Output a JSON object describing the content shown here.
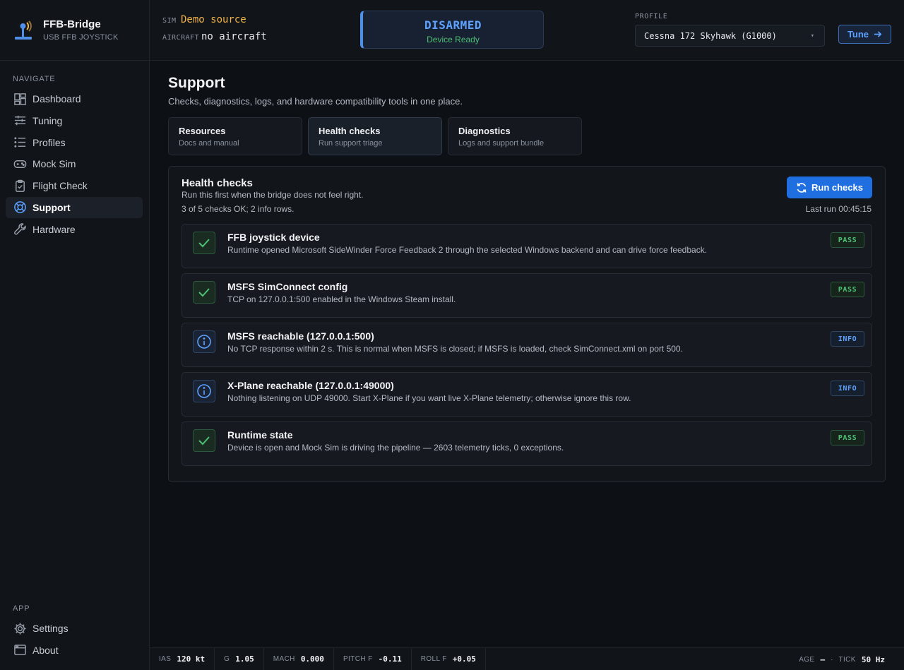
{
  "app": {
    "name": "FFB-Bridge",
    "subtitle": "USB FFB JOYSTICK"
  },
  "sidebar": {
    "section_label": "NAVIGATE",
    "items": [
      {
        "label": "Dashboard",
        "icon": "dashboard-icon"
      },
      {
        "label": "Tuning",
        "icon": "sliders-icon"
      },
      {
        "label": "Profiles",
        "icon": "list-icon"
      },
      {
        "label": "Mock Sim",
        "icon": "gamepad-icon"
      },
      {
        "label": "Flight Check",
        "icon": "clipboard-check-icon"
      },
      {
        "label": "Support",
        "icon": "lifebuoy-icon",
        "active": true
      },
      {
        "label": "Hardware",
        "icon": "wrench-icon"
      }
    ],
    "app_label": "APP",
    "app_items": [
      {
        "label": "Settings",
        "icon": "gear-icon"
      },
      {
        "label": "About",
        "icon": "window-icon"
      }
    ]
  },
  "topbar": {
    "sim_key": "SIM",
    "sim_value": "Demo source",
    "aircraft_key": "AIRCRAFT",
    "aircraft_value": "no aircraft",
    "arm_state": "DISARMED",
    "arm_sub": "Device Ready",
    "profile_label": "PROFILE",
    "profile_value": "Cessna 172 Skyhawk (G1000)",
    "tune_label": "Tune"
  },
  "page": {
    "title": "Support",
    "subtitle": "Checks, diagnostics, logs, and hardware compatibility tools in one place.",
    "tabs": [
      {
        "title": "Resources",
        "sub": "Docs and manual"
      },
      {
        "title": "Health checks",
        "sub": "Run support triage",
        "active": true
      },
      {
        "title": "Diagnostics",
        "sub": "Logs and support bundle"
      }
    ]
  },
  "health": {
    "title": "Health checks",
    "subtitle": "Run this first when the bridge does not feel right.",
    "summary": "3 of 5 checks OK; 2 info rows.",
    "run_label": "Run checks",
    "last_run": "Last run 00:45:15",
    "checks": [
      {
        "title": "FFB joystick device",
        "desc": "Runtime opened Microsoft SideWinder Force Feedback 2 through the selected Windows backend and can drive force feedback.",
        "status": "PASS"
      },
      {
        "title": "MSFS SimConnect config",
        "desc": "TCP on 127.0.0.1:500 enabled in the Windows Steam install.",
        "status": "PASS"
      },
      {
        "title": "MSFS reachable (127.0.0.1:500)",
        "desc": "No TCP response within 2 s. This is normal when MSFS is closed; if MSFS is loaded, check SimConnect.xml on port 500.",
        "status": "INFO"
      },
      {
        "title": "X-Plane reachable (127.0.0.1:49000)",
        "desc": "Nothing listening on UDP 49000. Start X-Plane if you want live X-Plane telemetry; otherwise ignore this row.",
        "status": "INFO"
      },
      {
        "title": "Runtime state",
        "desc": "Device is open and Mock Sim is driving the pipeline — 2603 telemetry ticks, 0 exceptions.",
        "status": "PASS"
      }
    ]
  },
  "statusbar": {
    "ias_key": "IAS",
    "ias_val": "120 kt",
    "g_key": "G",
    "g_val": "1.05",
    "mach_key": "MACH",
    "mach_val": "0.000",
    "pitch_key": "PITCH F",
    "pitch_val": "-0.11",
    "roll_key": "ROLL F",
    "roll_val": "+0.05",
    "age_key": "AGE",
    "age_val": "—",
    "tick_key": "TICK",
    "tick_val": "50 Hz"
  },
  "colors": {
    "accent": "#5ea2ff",
    "pass": "#4cc073",
    "demo": "#f0b34a",
    "primary_button": "#1f6fe0"
  }
}
